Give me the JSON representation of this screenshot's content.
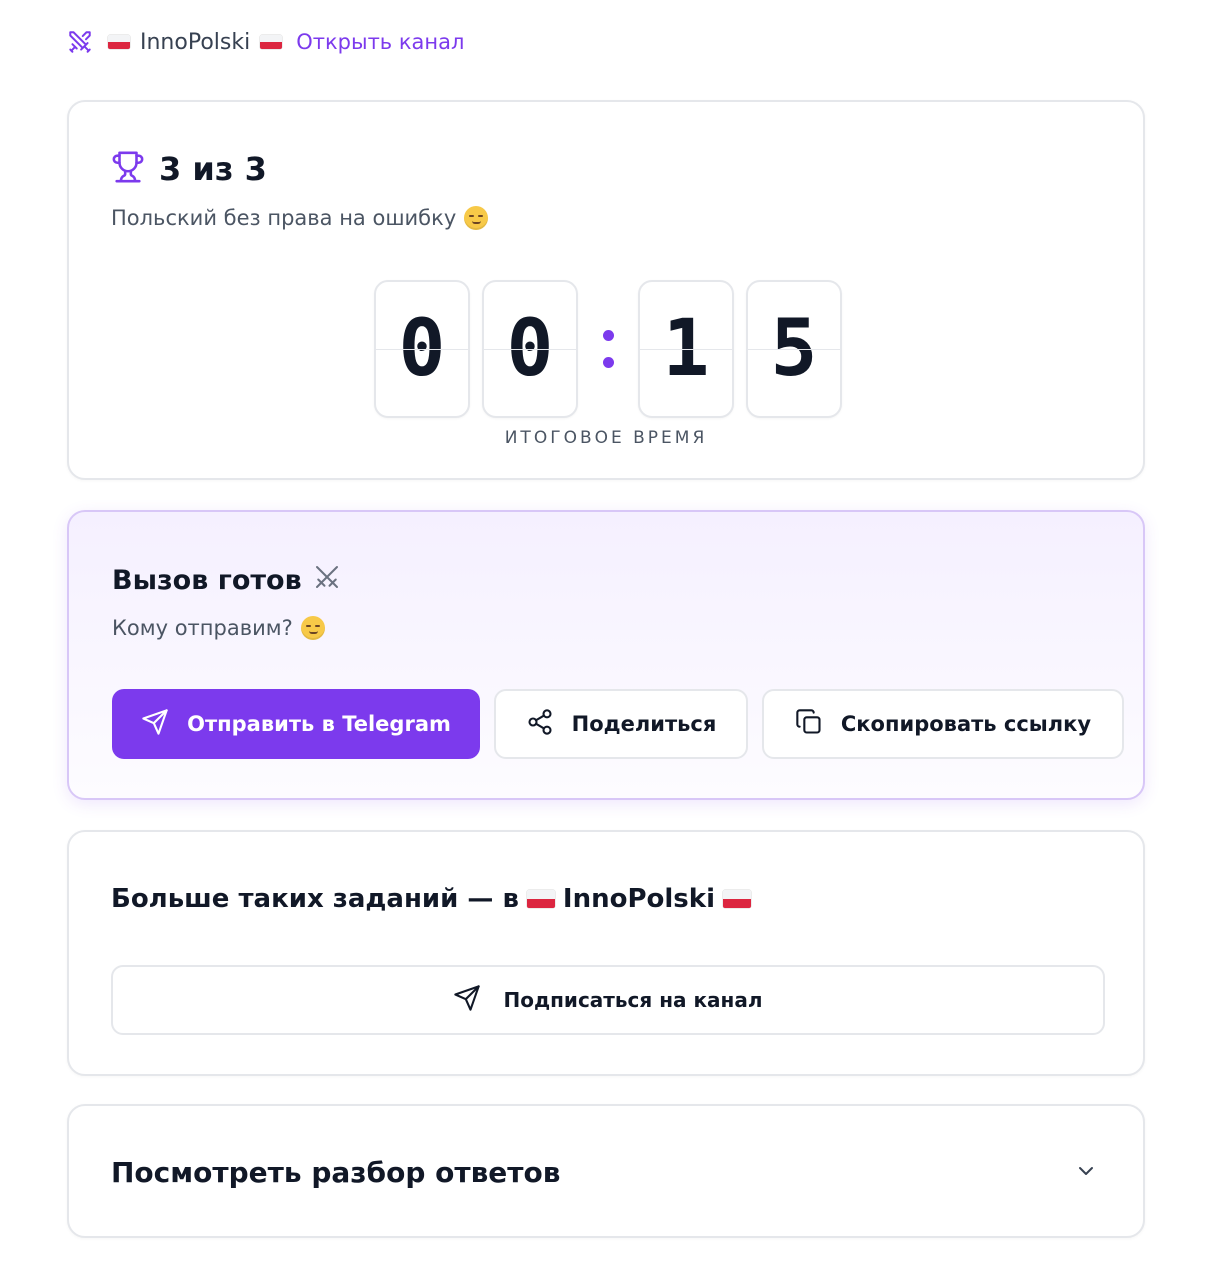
{
  "header": {
    "channel_name": "InnoPolski",
    "open_link": "Открыть канал"
  },
  "score": {
    "text": "3 из 3",
    "subtitle": "Польский без права на ошибку",
    "timer_digits": [
      "0",
      "0",
      "1",
      "5"
    ],
    "timer_label": "ИТОГОВОЕ ВРЕМЯ"
  },
  "challenge": {
    "title": "Вызов готов",
    "subtitle": "Кому отправим?",
    "send_telegram": "Отправить в Telegram",
    "share": "Поделиться",
    "copy_link": "Скопировать ссылку"
  },
  "subscribe": {
    "title_prefix": "Больше таких заданий — в",
    "channel": "InnoPolski",
    "button": "Подписаться на канал"
  },
  "answers": {
    "title": "Посмотреть разбор ответов"
  },
  "colors": {
    "accent": "#7c3aed",
    "flag_red": "#dc2640"
  }
}
